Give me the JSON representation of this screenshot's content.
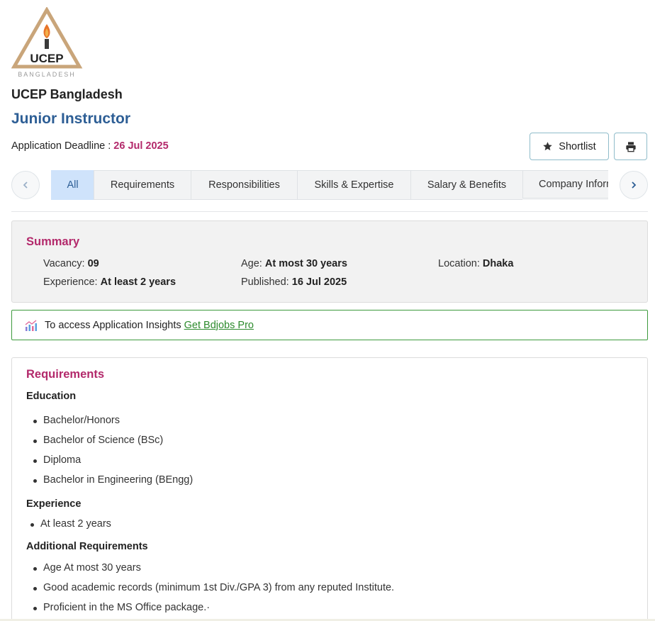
{
  "company": {
    "logo_main_text": "UCEP",
    "logo_sub_text": "BANGLADESH",
    "name": "UCEP Bangladesh"
  },
  "job": {
    "title": "Junior Instructor",
    "deadline_label": "Application Deadline :",
    "deadline_date": "26 Jul 2025"
  },
  "actions": {
    "shortlist_label": "Shortlist",
    "shortlist_icon": "star-icon",
    "print_icon": "printer-icon"
  },
  "tabs": [
    {
      "label": "All",
      "active": true
    },
    {
      "label": "Requirements",
      "active": false
    },
    {
      "label": "Responsibilities",
      "active": false
    },
    {
      "label": "Skills & Expertise",
      "active": false
    },
    {
      "label": "Salary & Benefits",
      "active": false
    },
    {
      "label": "Company Information",
      "active": false
    }
  ],
  "summary": {
    "title": "Summary",
    "vacancy_label": "Vacancy:",
    "vacancy_value": "09",
    "age_label": "Age:",
    "age_value": "At most 30 years",
    "location_label": "Location:",
    "location_value": "Dhaka",
    "experience_label": "Experience:",
    "experience_value": "At least 2 years",
    "published_label": "Published:",
    "published_value": "16 Jul 2025"
  },
  "insights": {
    "text": "To access Application Insights",
    "link": "Get Bdjobs Pro"
  },
  "requirements": {
    "title": "Requirements",
    "education_heading": "Education",
    "education": [
      "Bachelor/Honors",
      "Bachelor of Science (BSc)",
      "Diploma",
      "Bachelor in Engineering (BEngg)"
    ],
    "experience_heading": "Experience",
    "experience": [
      "At least 2 years"
    ],
    "additional_heading": "Additional Requirements",
    "additional": [
      "Age At most 30 years",
      "Good academic records (minimum 1st Div./GPA 3) from any reputed Institute.",
      "Proficient in the MS Office package.·"
    ]
  }
}
